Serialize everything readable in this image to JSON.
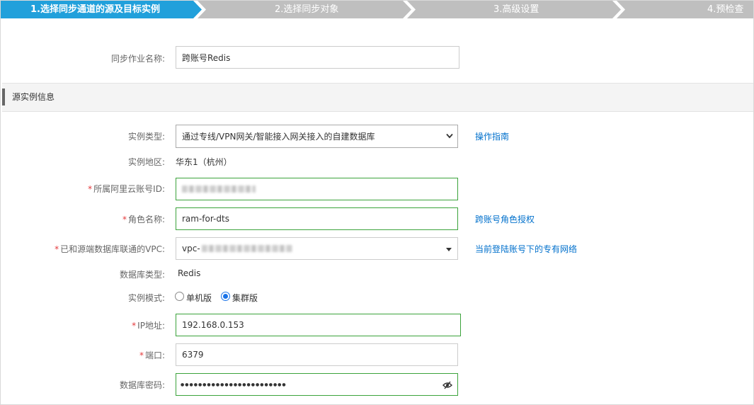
{
  "steps": [
    {
      "label": "1.选择同步通道的源及目标实例",
      "active": true
    },
    {
      "label": "2.选择同步对象",
      "active": false
    },
    {
      "label": "3.高级设置",
      "active": false
    },
    {
      "label": "4.预检查",
      "active": false
    }
  ],
  "colors": {
    "active_step": "#21a0db",
    "inactive_step": "#bfbfbf",
    "link": "#0070cc",
    "required": "#e4393c",
    "valid_border": "#3ba33b"
  },
  "task_name": {
    "label": "同步作业名称:",
    "value": "跨账号Redis"
  },
  "section_title": "源实例信息",
  "instance_type": {
    "label": "实例类型:",
    "value": "通过专线/VPN网关/智能接入网关接入的自建数据库",
    "link": "操作指南"
  },
  "region": {
    "label": "实例地区:",
    "value": "华东1（杭州）"
  },
  "account_id": {
    "label": "所属阿里云账号ID:",
    "required": "*"
  },
  "role_name": {
    "label": "角色名称:",
    "required": "*",
    "value": "ram-for-dts",
    "link": "跨账号角色授权"
  },
  "vpc": {
    "label": "已和源端数据库联通的VPC:",
    "required": "*",
    "value_prefix": "vpc-",
    "link": "当前登陆账号下的专有网络"
  },
  "db_type": {
    "label": "数据库类型:",
    "value": "Redis"
  },
  "instance_mode": {
    "label": "实例模式:",
    "options": [
      "单机版",
      "集群版"
    ],
    "selected": "集群版"
  },
  "ip": {
    "label": "IP地址:",
    "required": "*",
    "value": "192.168.0.153"
  },
  "port": {
    "label": "端口:",
    "required": "*",
    "value": "6379"
  },
  "password": {
    "label": "数据库密码:",
    "value": "●●●●●●●●●●●●●●●●●●●●●●●●"
  },
  "icons": {
    "select_caret": "chevron-down-icon",
    "password_toggle": "eye-slash-icon"
  }
}
